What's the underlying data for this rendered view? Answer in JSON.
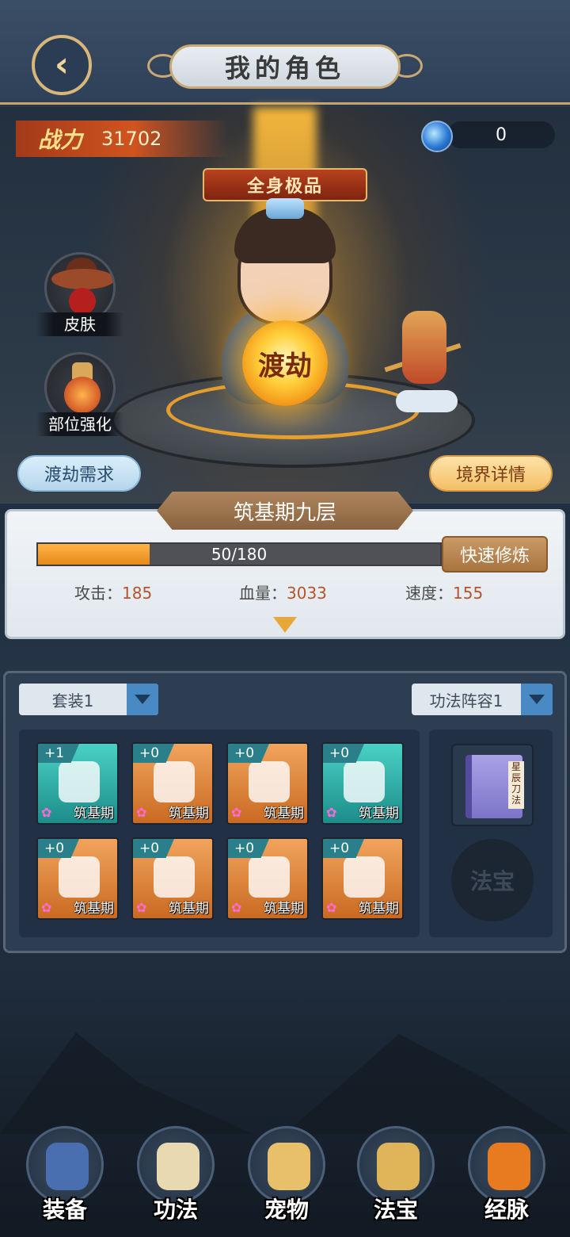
{
  "header": {
    "title": "我的角色"
  },
  "power": {
    "label": "战力",
    "value": "31702"
  },
  "currency": {
    "value": "0",
    "icon": "blue-orb-icon"
  },
  "character": {
    "quality_banner": "全身极品",
    "orb_label": "渡劫"
  },
  "side_buttons": [
    {
      "label": "皮肤",
      "icon": "hat-character-icon"
    },
    {
      "label": "部位强化",
      "icon": "cauldron-icon"
    }
  ],
  "actions": {
    "tribulation_req": "渡劫需求",
    "realm_detail": "境界详情"
  },
  "realm": {
    "name": "筑基期九层",
    "progress_current": 50,
    "progress_max": 180,
    "progress_text": "50/180",
    "quick_cultivate": "快速修炼",
    "stats": [
      {
        "label": "攻击：",
        "value": "185"
      },
      {
        "label": "血量：",
        "value": "3033"
      },
      {
        "label": "速度：",
        "value": "155"
      }
    ]
  },
  "equipment": {
    "set_dropdown": "套装1",
    "skill_dropdown": "功法阵容1",
    "slots": [
      {
        "plus": "+1",
        "realm": "筑基期",
        "rarity": "teal",
        "icon": "dagger-icon"
      },
      {
        "plus": "+0",
        "realm": "筑基期",
        "rarity": "orange",
        "icon": "armor-icon"
      },
      {
        "plus": "+0",
        "realm": "筑基期",
        "rarity": "orange",
        "icon": "skull-helm-icon"
      },
      {
        "plus": "+0",
        "realm": "筑基期",
        "rarity": "teal",
        "icon": "boots-icon"
      },
      {
        "plus": "+0",
        "realm": "筑基期",
        "rarity": "orange",
        "icon": "necklace-icon"
      },
      {
        "plus": "+0",
        "realm": "筑基期",
        "rarity": "orange",
        "icon": "belt-icon"
      },
      {
        "plus": "+0",
        "realm": "筑基期",
        "rarity": "orange",
        "icon": "ring-icon"
      },
      {
        "plus": "+0",
        "realm": "筑基期",
        "rarity": "orange",
        "icon": "jade-dragon-icon"
      }
    ],
    "book_label": "星辰刀法",
    "fabao_placeholder": "法宝"
  },
  "bottom_nav": [
    {
      "label": "装备",
      "icon": "armor-nav-icon",
      "color": "#4a6fb0"
    },
    {
      "label": "功法",
      "icon": "scroll-nav-icon",
      "color": "#e8d9b0"
    },
    {
      "label": "宠物",
      "icon": "pet-nav-icon",
      "color": "#e8c06a"
    },
    {
      "label": "法宝",
      "icon": "treasure-nav-icon",
      "color": "#e0b458"
    },
    {
      "label": "经脉",
      "icon": "meridian-nav-icon",
      "color": "#e87a20"
    }
  ]
}
